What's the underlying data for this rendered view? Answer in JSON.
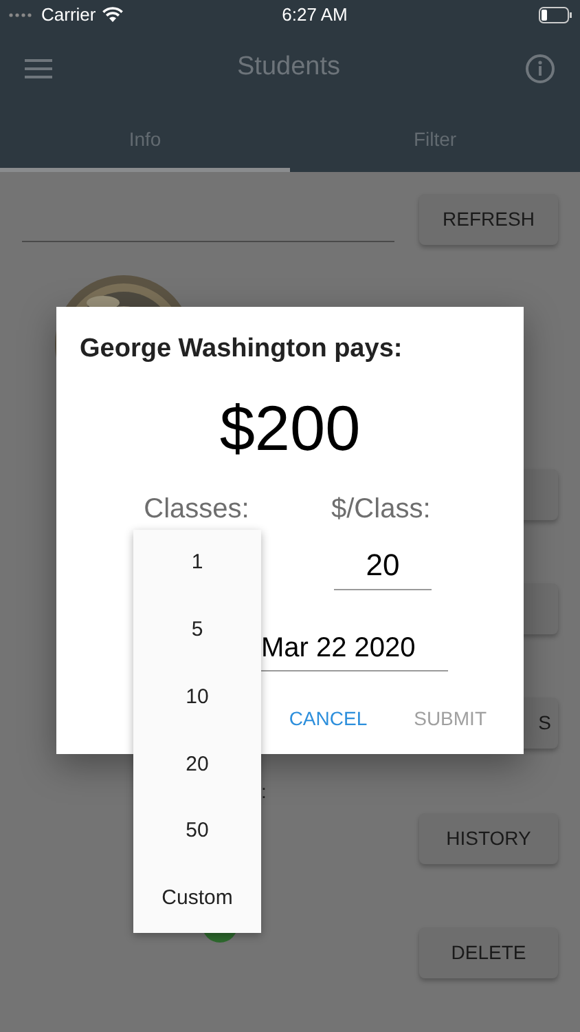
{
  "status_bar": {
    "carrier": "Carrier",
    "time": "6:27 AM"
  },
  "app_bar": {
    "title": "Students"
  },
  "tabs": [
    {
      "label": "Info",
      "selected": true
    },
    {
      "label": "Filter",
      "selected": false
    }
  ],
  "background": {
    "refresh_button": "REFRESH",
    "partial_button": "S",
    "fragment": ":",
    "history_button": "HISTORY",
    "delete_button": "DELETE"
  },
  "dialog": {
    "title": "George Washington pays:",
    "amount": "$200",
    "classes_label": "Classes:",
    "rate_label": "$/Class:",
    "rate_value": "20",
    "date_value": "Mar 22 2020",
    "buttons": [
      {
        "label": "CANCEL",
        "disabled": false
      },
      {
        "label": "SUBMIT",
        "disabled": true
      }
    ]
  },
  "classes_menu": {
    "options": [
      "1",
      "5",
      "10",
      "20",
      "50",
      "Custom"
    ]
  }
}
